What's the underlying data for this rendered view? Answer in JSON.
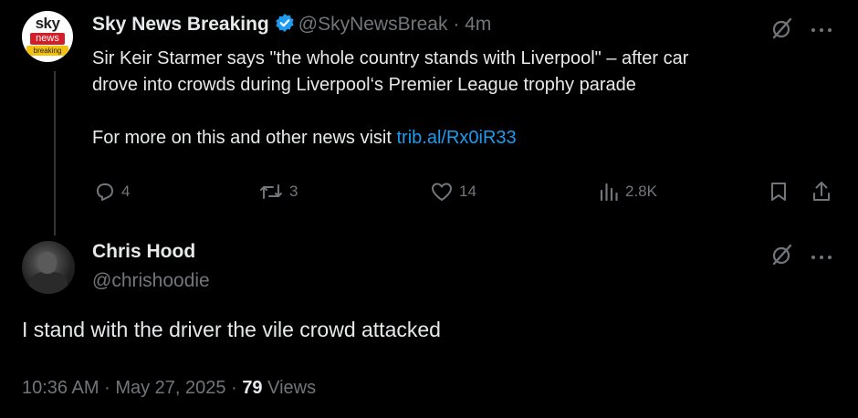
{
  "parent": {
    "avatar": {
      "line1": "sky",
      "line2": "news",
      "line3": "breaking"
    },
    "name": "Sky News Breaking",
    "handle": "@SkyNewsBreak",
    "separator": "·",
    "time": "4m",
    "text_line1": "Sir Keir Starmer says \"the whole country stands with Liverpool\" – after car",
    "text_line2": "drove into crowds during Liverpool‘s Premier League trophy parade",
    "text_line3": "For more on this and other news visit ",
    "link": "trib.al/Rx0iR33",
    "stats": {
      "replies": "4",
      "reposts": "3",
      "likes": "14",
      "views": "2.8K"
    }
  },
  "reply": {
    "name": "Chris Hood",
    "handle": "@chrishoodie",
    "text": "I stand with the driver the vile crowd attacked",
    "time": "10:36 AM",
    "date": "May 27, 2025",
    "dot1": "·",
    "dot2": "·",
    "views_count": "79",
    "views_label": "Views"
  },
  "colors": {
    "background": "#000000",
    "text": "#e7e9ea",
    "muted": "#71767b",
    "link": "#1d9bf0",
    "verified": "#1d9bf0"
  }
}
